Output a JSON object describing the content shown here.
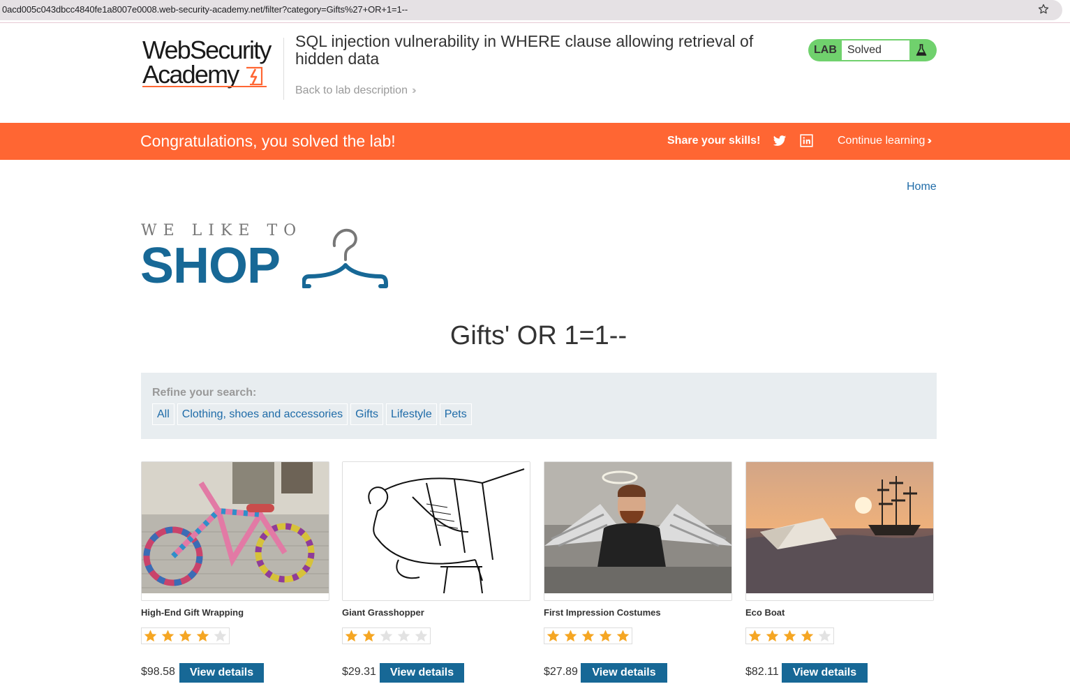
{
  "browser": {
    "url": "0acd005c043dbcc4840fe1a8007e0008.web-security-academy.net/filter?category=Gifts%27+OR+1=1--"
  },
  "lab_header": {
    "logo_line1": "WebSecurity",
    "logo_line2": "Academy",
    "title": "SQL injection vulnerability in WHERE clause allowing retrieval of hidden data",
    "back_link": "Back to lab description",
    "badge_label": "LAB",
    "badge_status": "Solved"
  },
  "banner": {
    "message": "Congratulations, you solved the lab!",
    "share_label": "Share your skills!",
    "continue_label": "Continue learning"
  },
  "nav": {
    "home": "Home"
  },
  "shop_logo": {
    "tagline": "WE LIKE TO",
    "word": "SHOP"
  },
  "page": {
    "heading": "Gifts' OR 1=1--"
  },
  "filter": {
    "label": "Refine your search:",
    "categories": [
      "All",
      "Clothing, shoes and accessories",
      "Gifts",
      "Lifestyle",
      "Pets"
    ]
  },
  "products": [
    {
      "name": "High-End Gift Wrapping",
      "rating": 4,
      "price": "$98.58",
      "button": "View details"
    },
    {
      "name": "Giant Grasshopper",
      "rating": 2,
      "price": "$29.31",
      "button": "View details"
    },
    {
      "name": "First Impression Costumes",
      "rating": 5,
      "price": "$27.89",
      "button": "View details"
    },
    {
      "name": "Eco Boat",
      "rating": 4,
      "price": "$82.11",
      "button": "View details"
    }
  ],
  "colors": {
    "brand_orange": "#ff6633",
    "brand_blue": "#176896",
    "link_blue": "#1e6ba8",
    "solved_green": "#70d16d",
    "star_gold": "#f5a623"
  }
}
